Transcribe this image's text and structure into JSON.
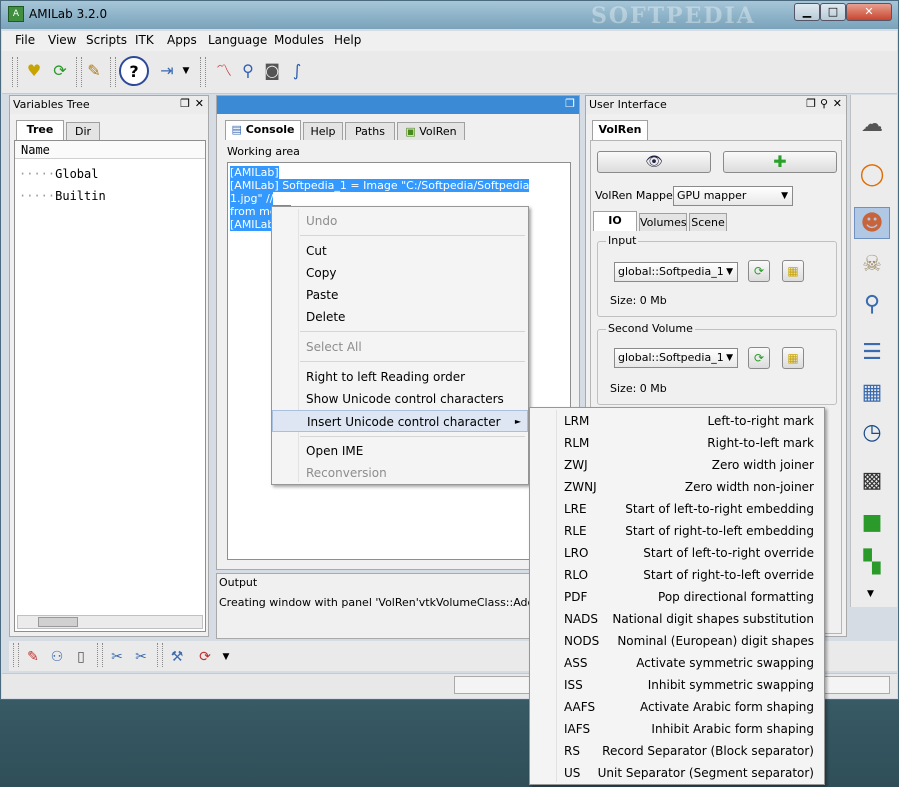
{
  "window": {
    "title": "AMILab 3.2.0",
    "watermark": "SOFTPEDIA",
    "controls": {
      "minimize": "▁",
      "maximize": "□",
      "close": "✕"
    }
  },
  "menubar": [
    "File",
    "View",
    "Scripts",
    "ITK",
    "Apps",
    "Language",
    "Modules",
    "Help"
  ],
  "toolbar_icons": [
    "open-script-icon",
    "reload-icon",
    "clean-icon",
    "help-icon",
    "exit-icon",
    "chart-icon",
    "zoom-icon",
    "camera-icon",
    "curve-icon"
  ],
  "variables_tree": {
    "title": "Variables Tree",
    "tabs": [
      "Tree",
      "Dir"
    ],
    "column_header": "Name",
    "items": [
      "Global",
      "Builtin"
    ]
  },
  "console_panel": {
    "tabs": [
      "Console",
      "Help",
      "Paths",
      "VolRen"
    ],
    "working_area_label": "Working area",
    "lines": [
      "[AMILab]",
      "[AMILab]  Softpedia_1 = Image \"C:/Softpedia/Softpedia 1.jpg\" //",
      "from menu",
      "[AMILab]"
    ],
    "output_label": "Output",
    "output_text": "Creating window with panel 'VolRen'vtkVolumeClass::AddGui end"
  },
  "user_interface": {
    "title": "User Interface",
    "tab": "VolRen",
    "mapper_label": "VolRen Mapper",
    "mapper_value": "GPU mapper",
    "sub_tabs": [
      "IO",
      "Volumes",
      "Scene"
    ],
    "input_group": {
      "title": "Input",
      "combo": "global::Softpedia_1",
      "size": "Size: 0 Mb"
    },
    "second_group": {
      "title": "Second Volume",
      "combo": "global::Softpedia_1",
      "size": "Size: 0 Mb"
    }
  },
  "context_menu": {
    "items": [
      {
        "label": "Undo",
        "disabled": true
      },
      {
        "label": "Cut",
        "disabled": false
      },
      {
        "label": "Copy",
        "disabled": false
      },
      {
        "label": "Paste",
        "disabled": false
      },
      {
        "label": "Delete",
        "disabled": false
      },
      {
        "label": "Select All",
        "disabled": true
      },
      {
        "label": "Right to left Reading order",
        "disabled": false
      },
      {
        "label": "Show Unicode control characters",
        "disabled": false
      },
      {
        "label": "Insert Unicode control character",
        "disabled": false
      },
      {
        "label": "Open IME",
        "disabled": false
      },
      {
        "label": "Reconversion",
        "disabled": true
      }
    ],
    "submenu_arrow": "►"
  },
  "unicode_submenu": [
    {
      "code": "LRM",
      "desc": "Left-to-right mark"
    },
    {
      "code": "RLM",
      "desc": "Right-to-left mark"
    },
    {
      "code": "ZWJ",
      "desc": "Zero width joiner"
    },
    {
      "code": "ZWNJ",
      "desc": "Zero width non-joiner"
    },
    {
      "code": "LRE",
      "desc": "Start of left-to-right embedding"
    },
    {
      "code": "RLE",
      "desc": "Start of right-to-left embedding"
    },
    {
      "code": "LRO",
      "desc": "Start of left-to-right override"
    },
    {
      "code": "RLO",
      "desc": "Start of right-to-left override"
    },
    {
      "code": "PDF",
      "desc": "Pop directional formatting"
    },
    {
      "code": "NADS",
      "desc": "National digit shapes substitution"
    },
    {
      "code": "NODS",
      "desc": "Nominal (European) digit shapes"
    },
    {
      "code": "ASS",
      "desc": "Activate symmetric swapping"
    },
    {
      "code": "ISS",
      "desc": "Inhibit symmetric swapping"
    },
    {
      "code": "AAFS",
      "desc": "Activate Arabic form shaping"
    },
    {
      "code": "IAFS",
      "desc": "Inhibit Arabic form shaping"
    },
    {
      "code": "RS",
      "desc": "Record Separator (Block separator)"
    },
    {
      "code": "US",
      "desc": "Unit Separator (Segment separator)"
    }
  ],
  "sidebar_icons": [
    "brain-icon",
    "torus-icon",
    "head-icon",
    "skull-icon",
    "magnifier-icon",
    "lines-icon",
    "calculator-icon",
    "clock-icon",
    "grid-icon",
    "cube-icon",
    "cubes-icon"
  ],
  "colors": {
    "selection": "#3399ff",
    "titlebar": "#8fb4c9",
    "panel": "#f0f0f0"
  }
}
